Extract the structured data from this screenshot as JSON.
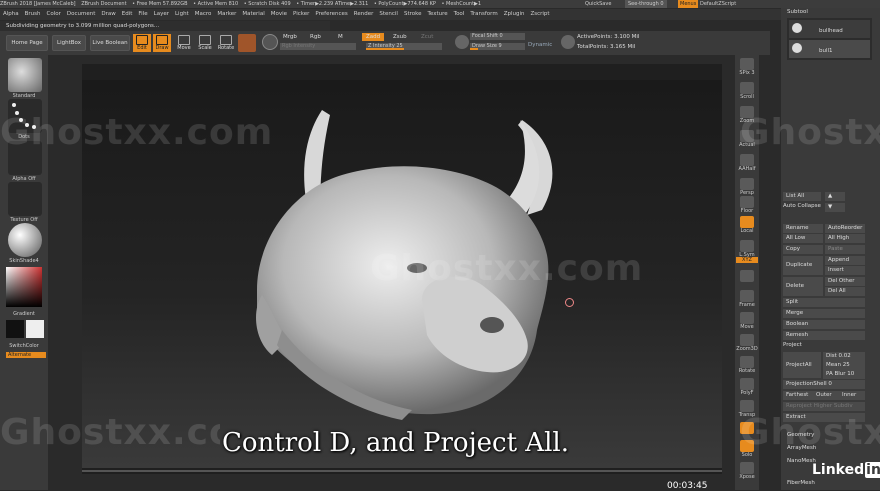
{
  "titlebar": {
    "items": [
      "ZBrush 2018 [James McCaleb]",
      "ZBrush Document",
      "• Free Mem 57.892GB",
      "• Active Mem 810",
      "• Scratch Disk 409",
      "• Timer▶2.239 ATime▶2.311",
      "• PolyCount▶774.648 KP",
      "• MeshCount▶1"
    ],
    "quicksave": "QuickSave",
    "seethrough": "See-through  0",
    "menus": "Menus",
    "defaultzscript": "DefaultZScript"
  },
  "menubar": {
    "items": [
      "Alpha",
      "Brush",
      "Color",
      "Document",
      "Draw",
      "Edit",
      "File",
      "Layer",
      "Light",
      "Macro",
      "Marker",
      "Material",
      "Movie",
      "Picker",
      "Preferences",
      "Render",
      "Stencil",
      "Stroke",
      "Texture",
      "Tool",
      "Transform",
      "Zplugin",
      "Zscript"
    ]
  },
  "status": "Subdividing geometry to 3.099 million quad-polygons...",
  "toolbar": {
    "home": "Home Page",
    "lightbox": "LightBox",
    "liveboolean": "Live Boolean",
    "edit": "Edit",
    "draw": "Draw",
    "move": "Move",
    "scale": "Scale",
    "rotate": "Rotate",
    "mrgb": "Mrgb",
    "rgb": "Rgb",
    "m": "M",
    "zadd": "Zadd",
    "zsub": "Zsub",
    "zcut": "Zcut",
    "rgbintensity": "Rgb Intensity",
    "zintensity": "Z Intensity 25",
    "focalshift": "Focal Shift 0",
    "drawsize": "Draw Size  9",
    "dynamic": "Dynamic",
    "activepoints": "ActivePoints: 3.100 Mil",
    "totalpoints": "TotalPoints: 3.165 Mil"
  },
  "leftpanel": {
    "standard": "Standard",
    "dots": "Dots",
    "alphaoff": "Alpha Off",
    "textureoff": "Texture Off",
    "skinshade": "SkinShade4",
    "gradient": "Gradient",
    "switchcolor": "SwitchColor",
    "alternate": "Alternate"
  },
  "dock": [
    "SPix 3",
    "Scroll",
    "Zoom",
    "Actual",
    "AAHalf",
    "Persp",
    "Floor",
    "Local",
    "L.Sym",
    "XYZ",
    "",
    "Frame",
    "Move",
    "Zoom3D",
    "Rotate",
    "PolyF",
    "Transp",
    "",
    "Solo",
    "Xpose"
  ],
  "subtool": {
    "header": "Subtool",
    "items": [
      "bullhead",
      "bull1"
    ]
  },
  "rightpanel": {
    "listall": "List All",
    "autocollapse": "Auto Collapse",
    "rename": "Rename",
    "autoreorder": "AutoReorder",
    "alllow": "All Low",
    "allhigh": "All High",
    "copy": "Copy",
    "paste": "Paste",
    "duplicate": "Duplicate",
    "append": "Append",
    "insert": "Insert",
    "delete": "Delete",
    "delother": "Del Other",
    "delall": "Del All",
    "split": "Split",
    "merge": "Merge",
    "boolean": "Boolean",
    "remesh": "Remesh",
    "project": "Project",
    "projectall": "ProjectAll",
    "dist": "Dist 0.02",
    "mean": "Mean 25",
    "pablur": "PA Blur 10",
    "projectionshell": "ProjectionShell 0",
    "farthest": "Farthest",
    "outer": "Outer",
    "inner": "Inner",
    "reproject": "Reproject Higher Subdiv",
    "extract": "Extract",
    "geometry": "Geometry",
    "arraymesh": "ArrayMesh",
    "nanomesh": "NanoMesh",
    "fibermesh": "FiberMesh"
  },
  "watermark": "Ghostxx.com",
  "subtitle": "Control D, and Project All.",
  "timecode": "00:03:45",
  "brand": {
    "linked": "Linked",
    "in": "in"
  },
  "colors": {
    "accent": "#e78b1e",
    "panel": "#3a3a3a"
  }
}
